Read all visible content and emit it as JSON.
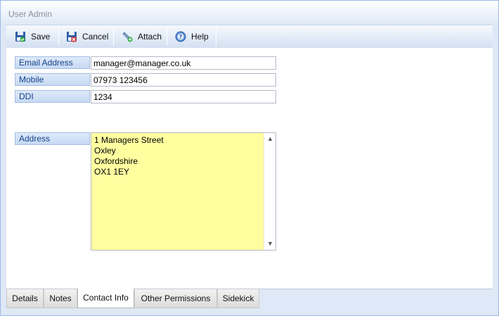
{
  "window": {
    "title": "User Admin"
  },
  "toolbar": {
    "buttons": [
      {
        "id": "save",
        "label": "Save",
        "icon": "save-icon"
      },
      {
        "id": "cancel",
        "label": "Cancel",
        "icon": "cancel-icon"
      },
      {
        "id": "attach",
        "label": "Attach",
        "icon": "attach-icon"
      },
      {
        "id": "help",
        "label": "Help",
        "icon": "help-icon"
      }
    ]
  },
  "form": {
    "email": {
      "label": "Email Address",
      "value": "manager@manager.co.uk"
    },
    "mobile": {
      "label": "Mobile",
      "value": "07973 123456"
    },
    "ddi": {
      "label": "DDI",
      "value": "1234"
    },
    "address": {
      "label": "Address",
      "lines": [
        "1 Managers Street",
        "Oxley",
        "Oxfordshire",
        "OX1 1EY"
      ]
    }
  },
  "tabs": [
    {
      "label": "Details",
      "active": false
    },
    {
      "label": "Notes",
      "active": false
    },
    {
      "label": "Contact Info",
      "active": true
    },
    {
      "label": "Other Permissions",
      "active": false
    },
    {
      "label": "Sidekick",
      "active": false
    }
  ],
  "colors": {
    "address_background": "#ffffa0",
    "label_text": "#15428b",
    "window_background": "#dfe8f6"
  }
}
